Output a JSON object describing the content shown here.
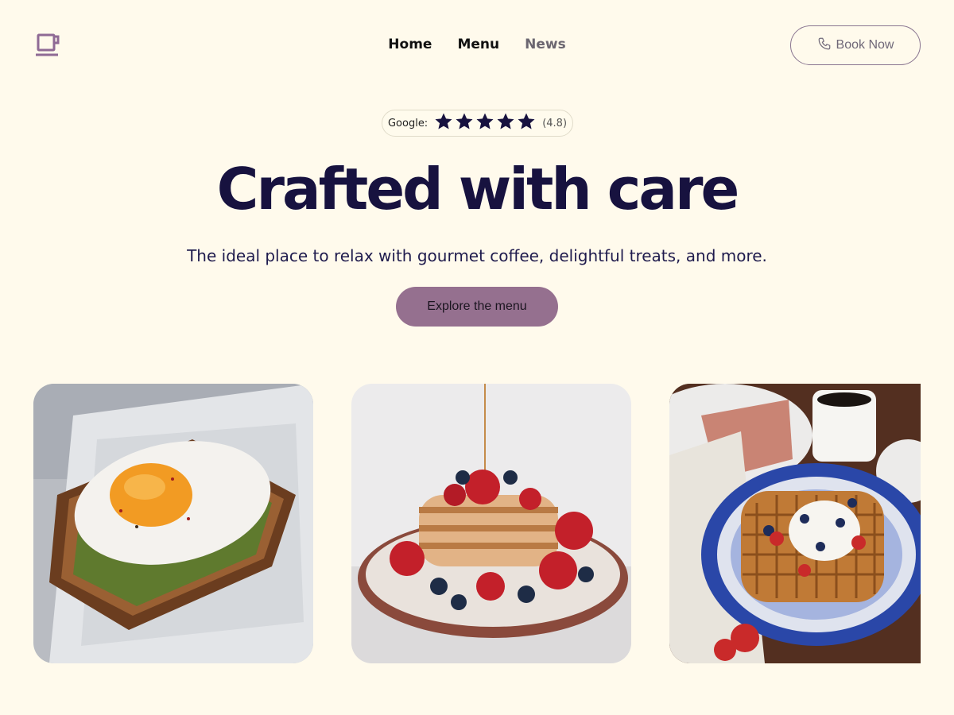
{
  "header": {
    "logo_icon": "coffee-cup-icon",
    "nav": [
      {
        "label": "Home"
      },
      {
        "label": "Menu"
      },
      {
        "label": "News"
      }
    ],
    "book_button": {
      "label": "Book Now",
      "icon": "phone-icon"
    }
  },
  "rating": {
    "source_label": "Google:",
    "stars": 5,
    "score_label": "(4.8)"
  },
  "hero": {
    "title": "Crafted with care",
    "subtitle": "The ideal place to relax with gourmet coffee, delightful treats, and more.",
    "cta_label": "Explore the menu"
  },
  "colors": {
    "background": "#fffaec",
    "accent": "#95708f",
    "heading": "#17123f",
    "star": "#17123f"
  },
  "gallery": [
    {
      "name": "fried-egg-avocado-toast-photo"
    },
    {
      "name": "berry-pancake-stack-photo"
    },
    {
      "name": "waffle-with-yogurt-and-berries-photo"
    }
  ]
}
